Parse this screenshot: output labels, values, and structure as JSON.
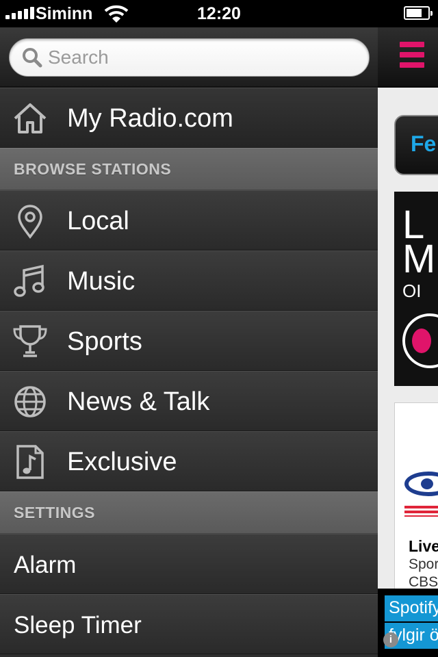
{
  "status_bar": {
    "carrier": "Siminn",
    "time": "12:20"
  },
  "search": {
    "placeholder": "Search",
    "value": ""
  },
  "menu": {
    "home_label": "My Radio.com",
    "browse_header": "BROWSE STATIONS",
    "browse_items": [
      {
        "label": "Local",
        "icon": "location-pin-icon"
      },
      {
        "label": "Music",
        "icon": "music-note-icon"
      },
      {
        "label": "Sports",
        "icon": "trophy-icon"
      },
      {
        "label": "News & Talk",
        "icon": "globe-icon"
      },
      {
        "label": "Exclusive",
        "icon": "music-file-icon"
      }
    ],
    "settings_header": "SETTINGS",
    "settings_items": [
      {
        "label": "Alarm"
      },
      {
        "label": "Sleep Timer"
      }
    ]
  },
  "content": {
    "tab_label": "Fe",
    "banner_lines": [
      "L",
      "M",
      "OI"
    ],
    "card_title": "Live",
    "card_line1": "Spor",
    "card_line2": "CBS",
    "ad_line1": "Spotify",
    "ad_line2": "fylgir ö"
  },
  "colors": {
    "accent": "#e0146a",
    "tab_text": "#1ea8e8",
    "menu_bg": "#2e2e2e",
    "section_bg": "#626262"
  }
}
